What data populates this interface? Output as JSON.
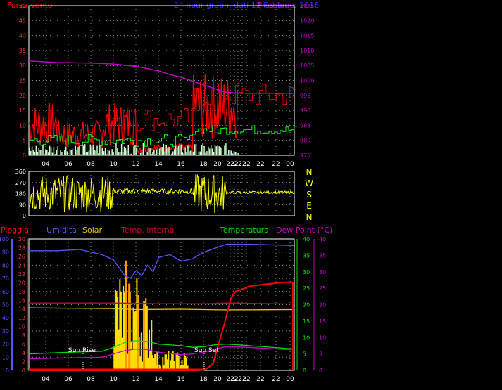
{
  "colors": {
    "wind": "#ff0000",
    "gust": "#00ff00",
    "windfill": "#ccffcc",
    "pressure": "#cc00cc",
    "direction": "#ffff00",
    "humidity": "#5555ff",
    "solar": "#e8c800",
    "temp_int": "#cc0033",
    "temperature": "#00dd00",
    "dewpoint": "#cc00cc",
    "rain": "#ff0000",
    "solarfill": "#ffdd00",
    "grid": "#ffffff",
    "axis": "#ffffff"
  },
  "top_panel": {
    "title_left": "Forza vento",
    "title_center": "24 hour graph, dati  12 Febbraio 2016",
    "title_right": "Pressione"
  },
  "direction_panel": {
    "compass": [
      "N",
      "W",
      "S",
      "E",
      "N"
    ]
  },
  "bottom_panel": {
    "title_rain": "Pioggia",
    "title_humidity": "Umidita",
    "title_solar": "Solar",
    "title_temp_int": "Temp. interna",
    "title_temperature": "Temperatura",
    "title_dewpoint": "Dew Point (°C)",
    "sun_rise": "Sun Rise",
    "sun_set": "Sun Set"
  },
  "x_tick_labels": [
    "04",
    "06",
    "08",
    "10",
    "12",
    "14",
    "16",
    "18",
    "20",
    "22",
    "22",
    "22",
    "22",
    "22",
    "22",
    "22",
    "00"
  ],
  "chart_data": [
    {
      "type": "line",
      "title": "",
      "xlabel": "",
      "ylabel": "Forza vento",
      "ylim": [
        0,
        50
      ],
      "y_ticks": [
        "0",
        "5",
        "10",
        "15",
        "20",
        "25",
        "30",
        "35",
        "40",
        "45",
        "50"
      ],
      "y2label": "Pressione",
      "y2lim": [
        975,
        1025
      ],
      "y2_ticks": [
        "975",
        "980",
        "985",
        "990",
        "995",
        "1000",
        "1005",
        "1010",
        "1015",
        "1020",
        "1025"
      ],
      "series": [
        {
          "name": "Pressione",
          "axis": "y2",
          "x": [
            2.5,
            5,
            8,
            10,
            12,
            14,
            15,
            16,
            17,
            18,
            19,
            20,
            21,
            22,
            26
          ],
          "values": [
            1006.5,
            1006,
            1005.8,
            1005.5,
            1004.7,
            1003.2,
            1002,
            1001,
            999.8,
            998.5,
            997.2,
            996,
            995.8,
            995.7,
            995.7
          ]
        }
      ]
    },
    {
      "type": "line",
      "ylim": [
        0,
        360
      ],
      "y_ticks": [
        "0",
        "90",
        "180",
        "270",
        "360"
      ]
    },
    {
      "type": "line",
      "title": "",
      "y_rain_lim": [
        0,
        100
      ],
      "y_rain_ticks": [
        "0",
        "10",
        "20",
        "30",
        "40",
        "50",
        "60",
        "70",
        "80",
        "90",
        "100"
      ],
      "y_solar_lim": [
        0,
        30
      ],
      "y_solar_ticks": [
        "0",
        "2",
        "4",
        "6",
        "8",
        "10",
        "12",
        "14",
        "16",
        "18",
        "20",
        "22",
        "24",
        "26",
        "28",
        "30"
      ],
      "y_temp_lim": [
        0,
        40
      ],
      "y_temp_ticks": [
        "0",
        "5",
        "10",
        "15",
        "20",
        "25",
        "30",
        "35",
        "40"
      ],
      "series": [
        {
          "name": "Umidita",
          "axis": "rain",
          "x": [
            2.5,
            5,
            7,
            9,
            10,
            11,
            11.5,
            12,
            12.5,
            13,
            13.5,
            14,
            15,
            16,
            17,
            18,
            19,
            20,
            22,
            26
          ],
          "values": [
            91,
            91,
            92,
            88,
            84,
            72,
            70,
            76,
            72,
            80,
            75,
            86,
            88,
            83,
            85,
            90,
            93,
            96,
            96,
            95
          ]
        },
        {
          "name": "Temperatura",
          "axis": "temp",
          "x": [
            2.5,
            6,
            9,
            10,
            11,
            12,
            13,
            14,
            16,
            17,
            18,
            19,
            20,
            22,
            26
          ],
          "values": [
            5,
            5.5,
            5.8,
            7,
            8.5,
            9,
            8.8,
            8,
            7.5,
            7,
            7.2,
            7.8,
            8,
            7.5,
            6.5
          ]
        },
        {
          "name": "Dew Point",
          "axis": "temp",
          "x": [
            2.5,
            6,
            9,
            10,
            11,
            12,
            13,
            14,
            16,
            17,
            18,
            19,
            20,
            22,
            26
          ],
          "values": [
            3.5,
            3.8,
            4,
            5,
            6,
            6.5,
            6.3,
            5.5,
            4.8,
            5,
            5.5,
            6.5,
            7.2,
            7,
            6.2
          ]
        },
        {
          "name": "Temp. interna",
          "axis": "temp",
          "x": [
            2.5,
            10,
            14,
            18,
            20,
            26
          ],
          "values": [
            20.5,
            20.5,
            20.3,
            20.3,
            20.5,
            20.2
          ]
        },
        {
          "name": "Solar",
          "axis": "temp",
          "x": [
            2.5,
            10,
            12,
            16,
            18,
            20,
            26
          ],
          "values": [
            19,
            18.8,
            18.5,
            18.6,
            18.5,
            18.4,
            18.5
          ]
        },
        {
          "name": "Pioggia",
          "axis": "rain",
          "x": [
            2.5,
            17.5,
            18.2,
            18.8,
            19.3,
            19.8,
            20.1,
            20.4,
            20.8,
            21.5,
            22,
            23,
            24,
            25,
            26
          ],
          "values": [
            0,
            0,
            1,
            5,
            20,
            35,
            45,
            55,
            60,
            62,
            64,
            65,
            66,
            67,
            67
          ]
        }
      ]
    }
  ]
}
